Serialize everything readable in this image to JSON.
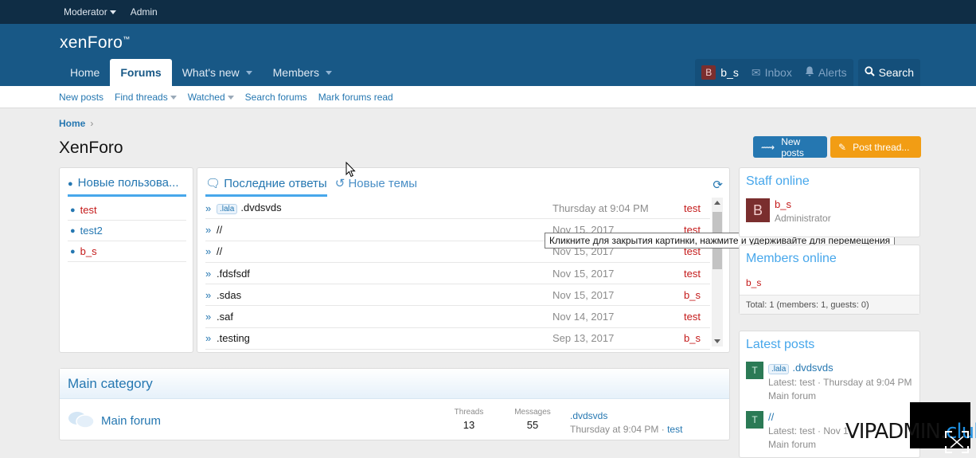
{
  "admin_bar": {
    "moderator": "Moderator",
    "admin": "Admin"
  },
  "header": {
    "logo": "xenForo",
    "logo_tm": "™",
    "nav": [
      {
        "label": "Home"
      },
      {
        "label": "Forums"
      },
      {
        "label": "What's new"
      },
      {
        "label": "Members"
      }
    ],
    "user": {
      "avatar_letter": "B",
      "name": "b_s"
    },
    "inbox": "Inbox",
    "alerts": "Alerts",
    "search": "Search"
  },
  "subnav": [
    "New posts",
    "Find threads",
    "Watched",
    "Search forums",
    "Mark forums read"
  ],
  "breadcrumb": {
    "home": "Home",
    "sep": "›"
  },
  "page_title": "XenForo",
  "buttons": {
    "new_posts": "New posts",
    "post_thread": "Post thread..."
  },
  "new_users": {
    "title": "Новые пользова...",
    "items": [
      {
        "name": "test",
        "color": "#c41a1a"
      },
      {
        "name": "test2",
        "color": "#2577b1"
      },
      {
        "name": "b_s",
        "color": "#c41a1a"
      }
    ]
  },
  "threads_widget": {
    "tab_recent": "Последние ответы",
    "tab_new": "Новые темы",
    "rows": [
      {
        "prefix": ".lala",
        "title": ".dvdsvds",
        "date": "Thursday at 9:04 PM",
        "user": "test"
      },
      {
        "prefix": "",
        "title": "//",
        "date": "Nov 15, 2017",
        "user": "test"
      },
      {
        "prefix": "",
        "title": "//",
        "date": "Nov 15, 2017",
        "user": "test"
      },
      {
        "prefix": "",
        "title": ".fdsfsdf",
        "date": "Nov 15, 2017",
        "user": "test"
      },
      {
        "prefix": "",
        "title": ".sdas",
        "date": "Nov 15, 2017",
        "user": "b_s"
      },
      {
        "prefix": "",
        "title": ".saf",
        "date": "Nov 14, 2017",
        "user": "test"
      },
      {
        "prefix": "",
        "title": ".testing",
        "date": "Sep 13, 2017",
        "user": "b_s"
      }
    ]
  },
  "tooltip": "Кликните для закрытия картинки, нажмите и удерживайте для перемещения",
  "category": {
    "title": "Main category",
    "forum": {
      "title": "Main forum",
      "threads_label": "Threads",
      "threads": "13",
      "messages_label": "Messages",
      "messages": "55",
      "last_title": ".dvdsvds",
      "last_date": "Thursday at 9:04 PM",
      "last_sep": "·",
      "last_user": "test"
    }
  },
  "staff_online": {
    "title": "Staff online",
    "avatar_letter": "B",
    "name": "b_s",
    "role": "Administrator"
  },
  "members_online": {
    "title": "Members online",
    "names": "b_s",
    "total": "Total: 1 (members: 1, guests: 0)"
  },
  "latest_posts": {
    "title": "Latest posts",
    "items": [
      {
        "avatar": "T",
        "prefix": ".lala",
        "title": ".dvdsvds",
        "meta": "Latest: test · Thursday at 9:04 PM",
        "forum": "Main forum"
      },
      {
        "avatar": "T",
        "prefix": "",
        "title": "//",
        "meta": "Latest: test · Nov 1",
        "forum": "Main forum"
      }
    ]
  },
  "watermark": {
    "part1": "VIPADMIN.",
    "part2": "club"
  },
  "colors": {
    "header": "#185886",
    "admin_bar": "#0f2d45",
    "accent": "#2577b1",
    "orange": "#f29d14",
    "user_red": "#c41a1a"
  }
}
